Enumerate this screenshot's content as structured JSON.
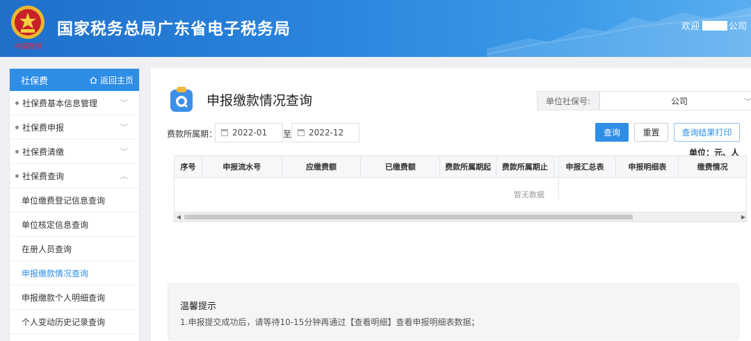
{
  "header": {
    "title": "国家税务总局广东省电子税务局",
    "emblem_caption": "中国税务",
    "welcome_prefix": "欢迎",
    "welcome_suffix": "公司"
  },
  "sidebar": {
    "title": "社保费",
    "home_label": "返回主页",
    "items": [
      {
        "label": "社保费基本信息管理",
        "chevron": "﹀"
      },
      {
        "label": "社保费申报",
        "chevron": "﹀"
      },
      {
        "label": "社保费清缴",
        "chevron": "﹀"
      },
      {
        "label": "社保费查询",
        "chevron": "︿"
      }
    ],
    "sub_items": [
      {
        "label": "单位缴费登记信息查询"
      },
      {
        "label": "单位核定信息查询"
      },
      {
        "label": "在册人员查询"
      },
      {
        "label": "申报缴款情况查询"
      },
      {
        "label": "申报缴款个人明细查询"
      },
      {
        "label": "个人变动历史记录查询"
      }
    ]
  },
  "main": {
    "title": "申报缴款情况查询",
    "unit_label": "单位社保号:",
    "unit_value": "公司",
    "period_label": "费款所属期：",
    "date_from": "2022-01",
    "to_label": "至",
    "date_to": "2022-12",
    "query_btn": "查询",
    "reset_btn": "重置",
    "print_btn": "查询结果打印",
    "units_note": "单位：元、人",
    "columns": [
      "序号",
      "申报流水号",
      "应缴费额",
      "已缴费额",
      "费款所属期起",
      "费款所属期止",
      "申报汇总表",
      "申报明细表",
      "缴费情况"
    ],
    "empty_text": "暂无数据"
  },
  "tips": {
    "title": "温馨提示",
    "text": "1.申报提交成功后，请等待10-15分钟再通过【查看明细】查看申报明细表数据；"
  },
  "colors": {
    "brand_blue": "#2e8ee6",
    "header_gradient_start": "#1f6fc9",
    "header_gradient_end": "#5aaef0"
  }
}
